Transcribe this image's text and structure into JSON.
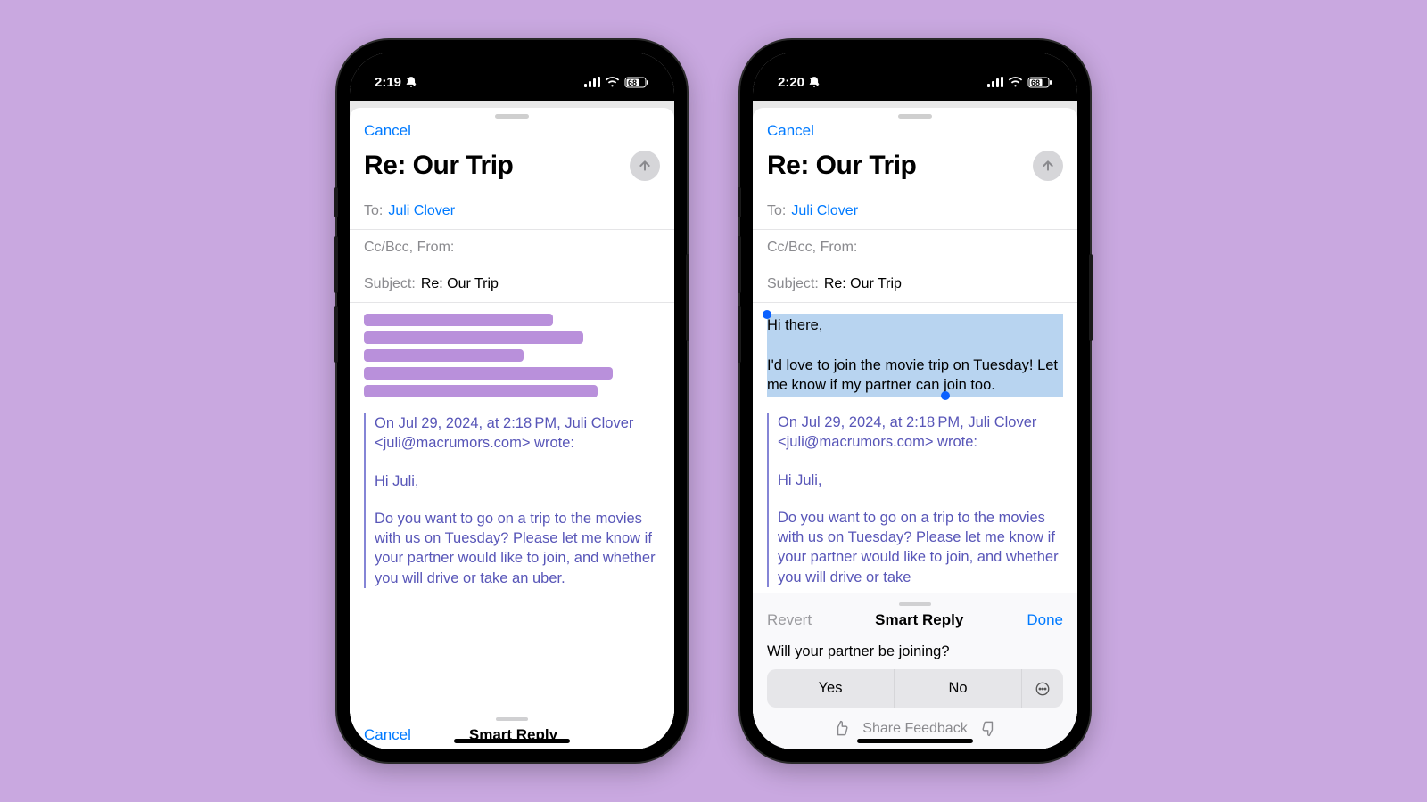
{
  "phone1": {
    "time": "2:19",
    "battery": "68",
    "cancel": "Cancel",
    "title": "Re: Our Trip",
    "to_label": "To:",
    "to_value": "Juli Clover",
    "ccbcc_label": "Cc/Bcc, From:",
    "subject_label": "Subject:",
    "subject_value": "Re: Our Trip",
    "quoted_header": "On Jul 29, 2024, at 2:18 PM, Juli Clover <juli@macrumors.com> wrote:",
    "quoted_greeting": "Hi Juli,",
    "quoted_body": "Do you want to go on a trip to the movies with us on Tuesday? Please let me know if your partner would like to join, and whether you will drive or take an uber.",
    "bottom_left": "Cancel",
    "bottom_center": "Smart Reply"
  },
  "phone2": {
    "time": "2:20",
    "battery": "68",
    "cancel": "Cancel",
    "title": "Re: Our Trip",
    "to_label": "To:",
    "to_value": "Juli Clover",
    "ccbcc_label": "Cc/Bcc, From:",
    "subject_label": "Subject:",
    "subject_value": "Re: Our Trip",
    "draft_greeting": "Hi there,",
    "draft_body": "I'd love to join the movie trip on Tuesday! Let me know if my partner can join too.",
    "quoted_header": "On Jul 29, 2024, at 2:18 PM, Juli Clover <juli@macrumors.com> wrote:",
    "quoted_greeting": "Hi Juli,",
    "quoted_body": "Do you want to go on a trip to the movies with us on Tuesday? Please let me know if your partner would like to join, and whether you will drive or take",
    "bottom_left": "Revert",
    "bottom_center": "Smart Reply",
    "bottom_right": "Done",
    "question": "Will your partner be joining?",
    "option_yes": "Yes",
    "option_no": "No",
    "feedback": "Share Feedback"
  }
}
